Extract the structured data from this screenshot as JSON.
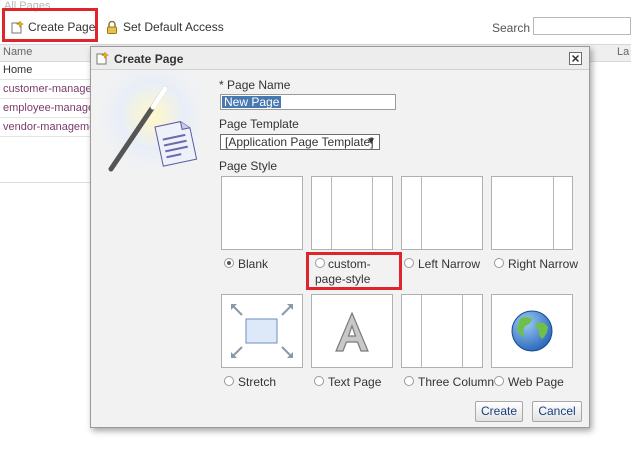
{
  "background": {
    "header": "All Pages",
    "toolbar": {
      "create_page": "Create Page",
      "set_default_access": "Set Default Access",
      "search_label": "Search"
    },
    "table": {
      "col_name": "Name",
      "col_last": "La",
      "rows": [
        "Home",
        "customer-manage",
        "employee-manage",
        "vendor-manageme"
      ]
    }
  },
  "dialog": {
    "title": "Create Page",
    "page_name_required": "*",
    "page_name_label": "Page Name",
    "page_name_value": "New Page",
    "page_template_label": "Page Template",
    "page_template_value": "[Application Page Template]",
    "page_style_label": "Page Style",
    "styles": [
      {
        "label": "Blank",
        "selected": true
      },
      {
        "label": "custom-page-style",
        "selected": false
      },
      {
        "label": "Left Narrow",
        "selected": false
      },
      {
        "label": "Right Narrow",
        "selected": false
      },
      {
        "label": "Stretch",
        "selected": false
      },
      {
        "label": "Text Page",
        "selected": false
      },
      {
        "label": "Three Column",
        "selected": false
      },
      {
        "label": "Web Page",
        "selected": false
      }
    ],
    "create_button": "Create",
    "cancel_button": "Cancel"
  },
  "colors": {
    "highlight_box": "#e0242c",
    "selection": "#4878b0",
    "link": "#7a3b6b"
  }
}
